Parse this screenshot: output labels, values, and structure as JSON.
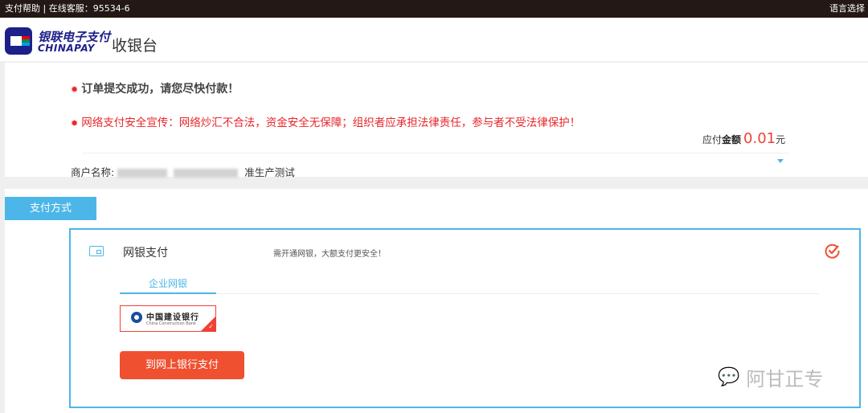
{
  "topbar": {
    "help": "支付帮助 | 在线客服：95534-6",
    "language": "语言选择"
  },
  "header": {
    "brand_cn": "银联电子支付",
    "brand_en": "CHINAPAY",
    "title": "收银台"
  },
  "order": {
    "success_msg": "订单提交成功，请您尽快付款！",
    "warning_msg": "网络支付安全宣传：网络炒汇不合法，资金安全无保障；组织者应承担法律责任，参与者不受法律保护！",
    "amount_prefix": "应付",
    "amount_label": "金额",
    "amount_value": "0.01",
    "amount_unit": "元",
    "merchant_label": "商户名称:",
    "merchant_suffix": "准生产测试"
  },
  "payment": {
    "tab_label": "支付方式",
    "method_name": "网银支付",
    "method_desc": "需开通网银，大额支付更安全！",
    "subtab": "企业网银",
    "bank_cn": "中国建设银行",
    "bank_en": "China Construction Bank",
    "pay_button": "到网上银行支付"
  },
  "watermark": {
    "text": "阿甘正专"
  },
  "colors": {
    "accent": "#4db6e8",
    "primary_button": "#ef5030",
    "warning": "#e8262a",
    "topbar": "#231815"
  }
}
